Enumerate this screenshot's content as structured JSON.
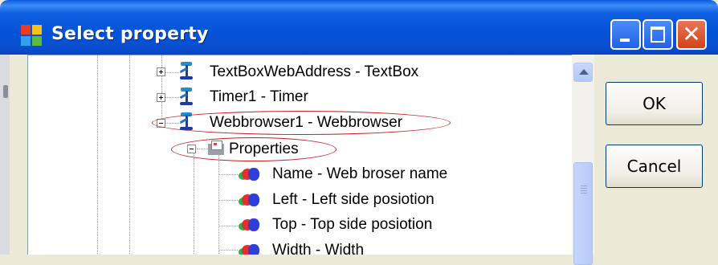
{
  "window": {
    "title": "Select property"
  },
  "caption_buttons": {
    "close_glyph": "✕"
  },
  "tree": {
    "items": [
      {
        "label": "TextBoxWebAddress - TextBox",
        "type": "control",
        "expander": "+"
      },
      {
        "label": "Timer1 - Timer",
        "type": "control",
        "expander": "+"
      },
      {
        "label": "Webbrowser1 - Webbrowser",
        "type": "control",
        "expander": "-"
      },
      {
        "label": "Properties",
        "type": "folder",
        "expander": "-"
      },
      {
        "label": "Name - Web broser name",
        "type": "property"
      },
      {
        "label": "Left - Left side posiotion",
        "type": "property"
      },
      {
        "label": "Top - Top side posiotion",
        "type": "property"
      },
      {
        "label": "Width - Width",
        "type": "property"
      }
    ]
  },
  "buttons": {
    "ok": "OK",
    "cancel": "Cancel"
  },
  "colors": {
    "highlight_ellipse": "#c91e1e",
    "titlebar": "#0553d8"
  }
}
